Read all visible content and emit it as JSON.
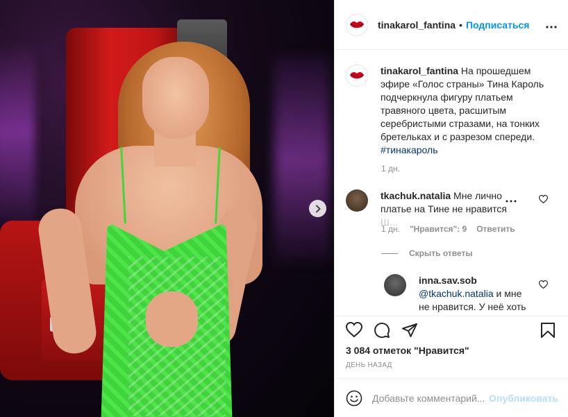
{
  "post": {
    "username": "tinakarol_fantina",
    "follow_label": "Подписаться",
    "more_label": "•••",
    "separator": "•"
  },
  "caption": {
    "username": "tinakarol_fantina",
    "text": " На прошедшем эфире «Голос страны» Тина Кароль подчеркнула фигуру платьем травяного цвета, расшитым серебристыми стразами, на тонких бретельках и с разрезом спереди. ",
    "hashtag": "#тинакароль",
    "time": "1 дн."
  },
  "comment": {
    "username": "tkachuk.natalia",
    "text": " Мне лично платье на Тине не нравится",
    "faded_text": " Ш...",
    "more_label": "•••",
    "time": "1 дн.",
    "likes_label": "\"Нравится\": 9",
    "reply_label": "Ответить",
    "hide_replies_label": "Скрыть ответы"
  },
  "reply": {
    "username": "inna.sav.sob",
    "mention": "@tkachuk.natalia",
    "text": " и мне не нравится. У неё хоть"
  },
  "actions": {
    "likes_count": "3 084 отметок \"Нравится\"",
    "date": "День назад"
  },
  "add_comment": {
    "placeholder": "Добавьте комментарий...",
    "publish_label": "Опубликовать"
  },
  "colors": {
    "accent": "#0095f6",
    "publish_disabled": "#b2dffc",
    "lips": "#d0021b"
  },
  "icons": [
    "lips-logo-icon",
    "more-icon",
    "heart-icon",
    "comment-icon",
    "share-icon",
    "bookmark-icon",
    "emoji-icon",
    "chevron-right-icon"
  ]
}
